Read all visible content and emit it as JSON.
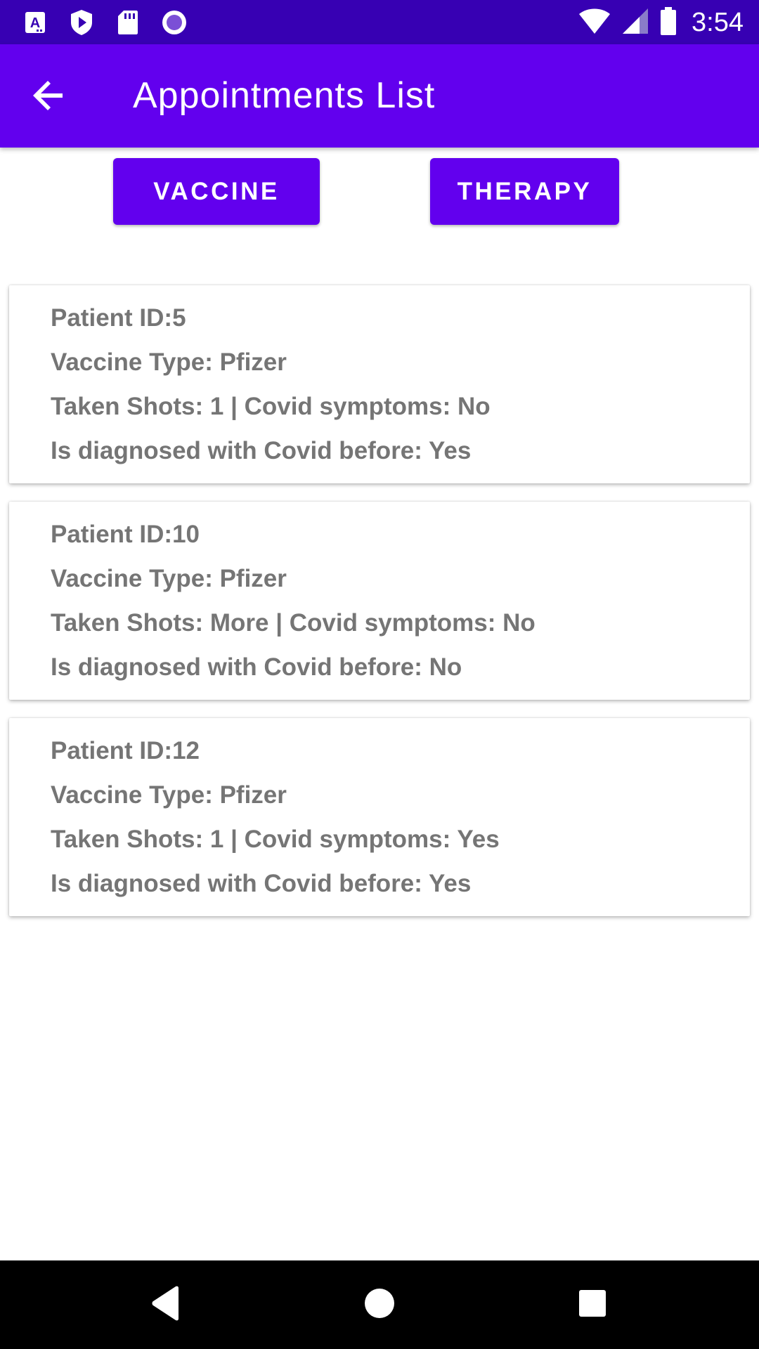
{
  "status_bar": {
    "time": "3:54",
    "left_icons": [
      "text-app-icon",
      "play-protect-icon",
      "sd-card-icon",
      "circle-notification-icon"
    ],
    "right_icons": [
      "wifi-icon",
      "cellular-signal-icon",
      "battery-icon"
    ]
  },
  "app_bar": {
    "title": "Appointments List",
    "back_icon": "arrow-back-icon"
  },
  "tabs": {
    "vaccine_label": "VACCINE",
    "therapy_label": "THERAPY"
  },
  "appointments": [
    {
      "patient": "Patient ID:5",
      "vaccine_type": "Vaccine Type: Pfizer",
      "shots_symptoms": "Taken Shots: 1 | Covid symptoms: No",
      "diagnosed": "Is diagnosed with Covid before: Yes"
    },
    {
      "patient": "Patient ID:10",
      "vaccine_type": "Vaccine Type: Pfizer",
      "shots_symptoms": "Taken Shots: More | Covid symptoms: No",
      "diagnosed": "Is diagnosed with Covid before: No"
    },
    {
      "patient": "Patient ID:12",
      "vaccine_type": "Vaccine Type: Pfizer",
      "shots_symptoms": "Taken Shots: 1 | Covid symptoms: Yes",
      "diagnosed": "Is diagnosed with Covid before: Yes"
    }
  ],
  "nav_bar": {
    "icons": [
      "nav-back-icon",
      "nav-home-icon",
      "nav-recents-icon"
    ]
  },
  "colors": {
    "status_bar": "#3700B3",
    "primary": "#6200EE",
    "card_text": "#757575",
    "nav_bar": "#000000"
  }
}
